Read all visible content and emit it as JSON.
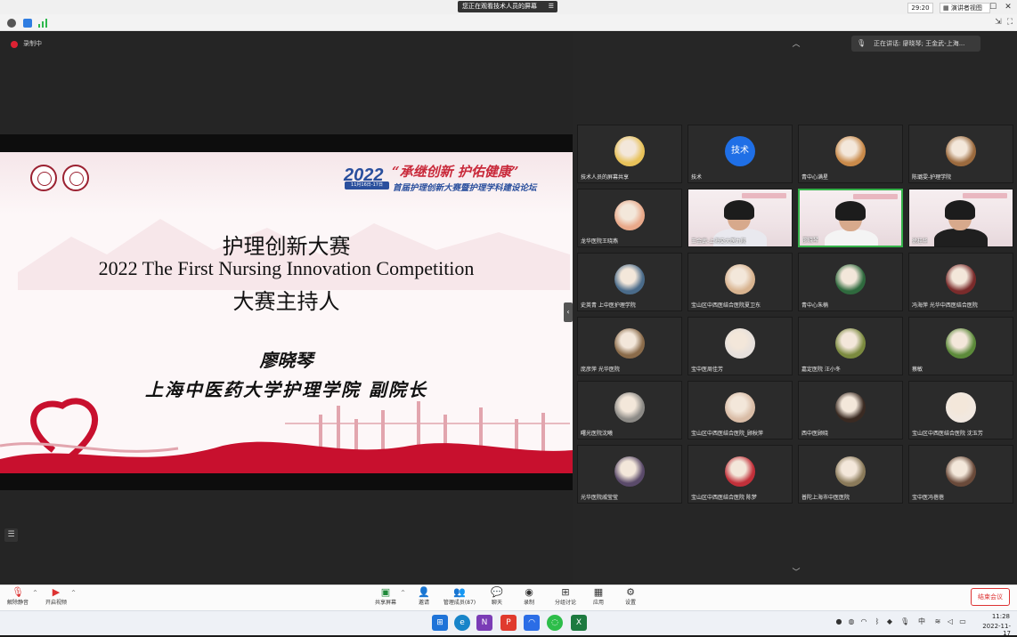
{
  "window": {
    "sharing_banner": "您正在观看技术人员的屏幕",
    "timer": "29:20",
    "view_label": "演讲者视图"
  },
  "recording": {
    "label": "录制中"
  },
  "speaker": {
    "text": "正在讲话: 廖晓琴; 王金武-上海..."
  },
  "slide": {
    "year": "2022",
    "date": "11月16日-17日",
    "slogan": "“承继创新 护佑健康”",
    "subtitle": "首届护理创新大赛暨护理学科建设论坛",
    "title_cn": "护理创新大赛",
    "title_en": "2022 The First Nursing Innovation Competition",
    "host_label": "大赛主持人",
    "host_name": "廖晓琴",
    "host_org": "上海中医药大学护理学院 副院长"
  },
  "participants": [
    {
      "name": "技术人员的屏幕共享",
      "avatar": "photo",
      "color": "#e8c25a"
    },
    {
      "name": "技术",
      "avatar": "text",
      "initials": "技术"
    },
    {
      "name": "青中心满星",
      "avatar": "photo",
      "color": "#c98a4a"
    },
    {
      "name": "陈璐雯-护理学院",
      "avatar": "photo",
      "color": "#9b6a3e"
    },
    {
      "name": "龙华医院王晓燕",
      "avatar": "photo",
      "color": "#e9a98a"
    },
    {
      "name": "王金武-上海交大医九院",
      "avatar": "video",
      "active": false,
      "shirt": "#e9e9ef"
    },
    {
      "name": "廖晓琴",
      "avatar": "video",
      "active": true,
      "shirt": "#f4f4f4"
    },
    {
      "name": "徐桂华",
      "avatar": "video",
      "active": false,
      "shirt": "#1f1f1f"
    },
    {
      "name": "史英青 上中医护理学院",
      "avatar": "photo",
      "color": "#4a6b8a"
    },
    {
      "name": "宝山区中西医结合医院夏卫东",
      "avatar": "photo",
      "color": "#d8b38f"
    },
    {
      "name": "青中心朱楠",
      "avatar": "photo",
      "color": "#2f6a3e"
    },
    {
      "name": "冯海萍 光华中西医结合医院",
      "avatar": "photo",
      "color": "#7a2b2b"
    },
    {
      "name": "庞彦萍 光华医院",
      "avatar": "photo",
      "color": "#8a6b4a"
    },
    {
      "name": "宝中医周佳芳",
      "avatar": "photo",
      "color": "#e6e0dc"
    },
    {
      "name": "嘉定医院 汪小冬",
      "avatar": "photo",
      "color": "#7b8a3f"
    },
    {
      "name": "蔡敏",
      "avatar": "photo",
      "color": "#5c8a3a"
    },
    {
      "name": "曙光医院沈曦",
      "avatar": "photo",
      "color": "#8c8a86"
    },
    {
      "name": "宝山区中西医结合医院_顾秋萍",
      "avatar": "photo",
      "color": "#d9bca6"
    },
    {
      "name": "西中医顾晓",
      "avatar": "photo",
      "color": "#3a2a22"
    },
    {
      "name": "宝山区中西医结合医院 沈玉芳",
      "avatar": "photo",
      "color": "#f1e8e0"
    },
    {
      "name": "光华医院戚莹莹",
      "avatar": "photo",
      "color": "#5a4a6a"
    },
    {
      "name": "宝山区中西医结合医院 陈梦",
      "avatar": "photo",
      "color": "#c2303a"
    },
    {
      "name": "普陀上海市中医医院",
      "avatar": "photo",
      "color": "#8a7a5a"
    },
    {
      "name": "宝中医冯蓓蓓",
      "avatar": "photo",
      "color": "#6a4a3a"
    }
  ],
  "toolbar": {
    "mute": "解除静音",
    "video": "开启视频",
    "share": "共享屏幕",
    "invite": "邀请",
    "participants": "管理成员(87)",
    "chat": "聊天",
    "record": "录制",
    "breakout": "分组讨论",
    "apps": "应用",
    "settings": "设置",
    "end": "结束会议"
  },
  "taskbar": {
    "time": "11:28",
    "date": "2022-11-17",
    "ime": "中"
  }
}
